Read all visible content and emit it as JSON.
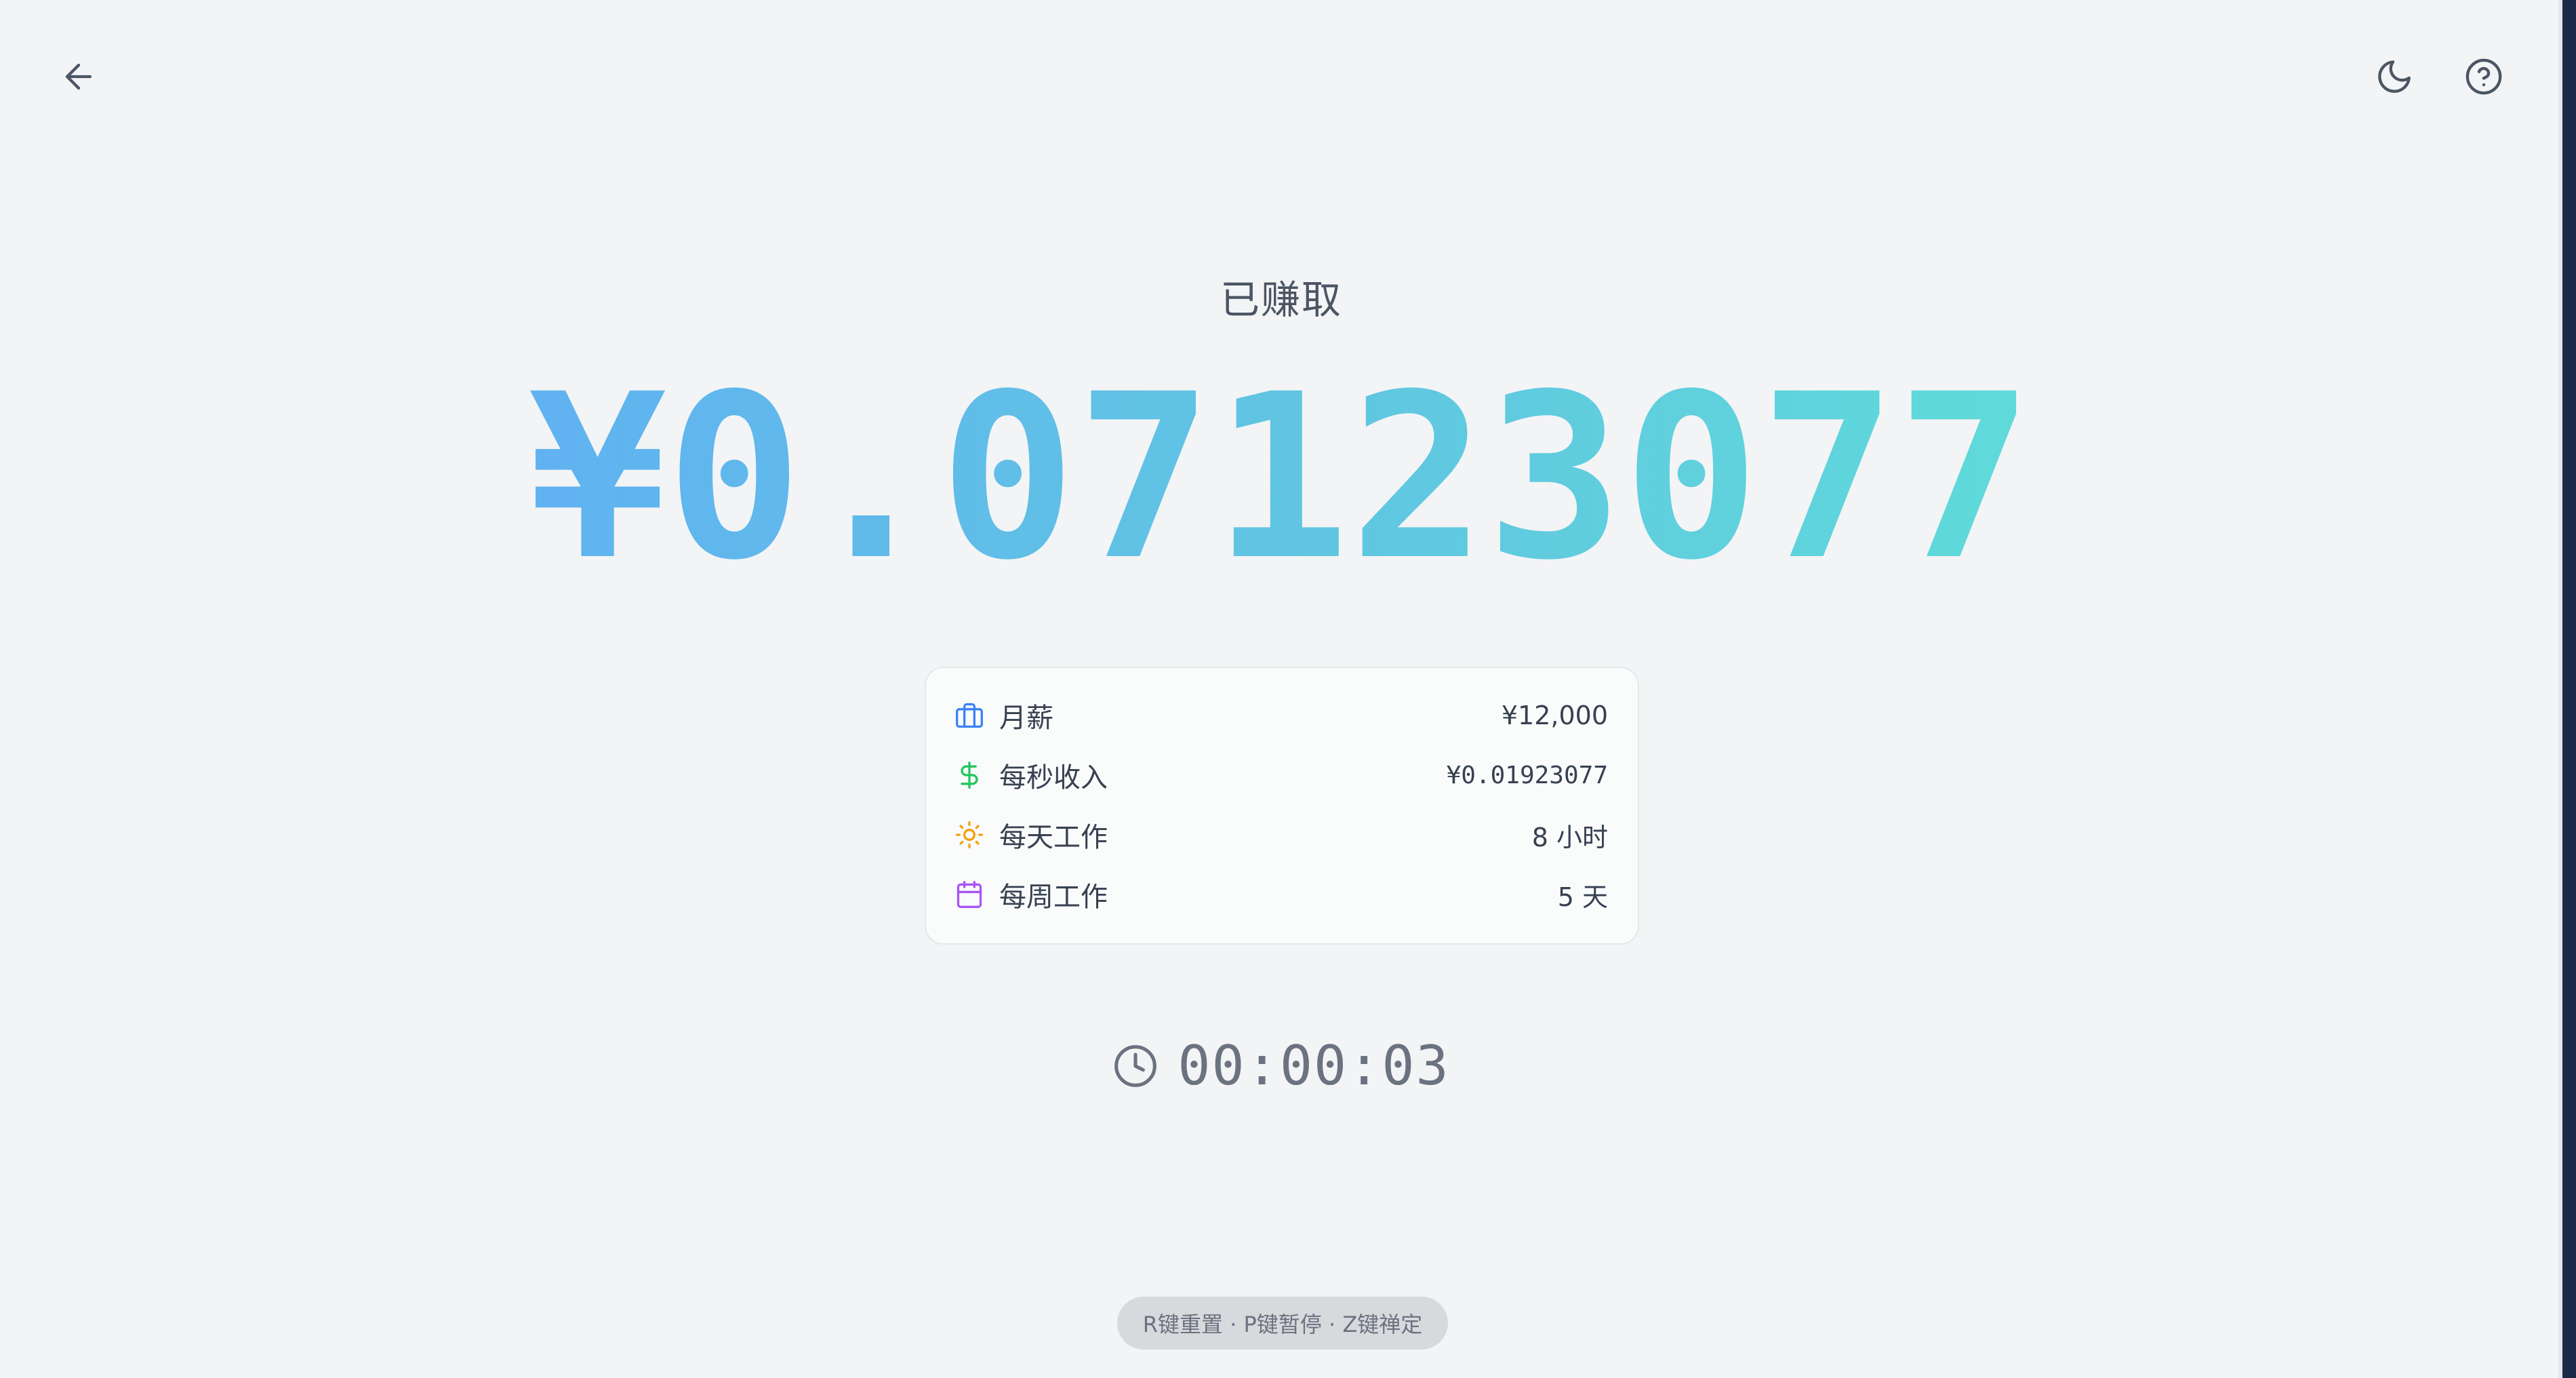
{
  "header": {
    "back_icon": "arrow-left-icon",
    "theme_icon": "moon-icon",
    "help_icon": "help-circle-icon"
  },
  "main": {
    "earned_label": "已赚取",
    "amount": "¥0.07123077"
  },
  "info_card": {
    "rows": [
      {
        "icon": "briefcase-icon",
        "label": "月薪",
        "value": "¥12,000",
        "color": "#3b82f6"
      },
      {
        "icon": "dollar-icon",
        "label": "每秒收入",
        "value": "¥0.01923077",
        "color": "#22c55e"
      },
      {
        "icon": "sun-icon",
        "label": "每天工作",
        "value": "8 小时",
        "color": "#f59e0b"
      },
      {
        "icon": "calendar-icon",
        "label": "每周工作",
        "value": "5 天",
        "color": "#a855f7"
      }
    ]
  },
  "timer": {
    "icon": "clock-icon",
    "elapsed": "00:00:03"
  },
  "footer": {
    "hint": "R键重置 · P键暂停 · Z键禅定"
  },
  "colors": {
    "background": "#f3f4f6",
    "gradient_start": "#60a5fa",
    "gradient_end": "#5eead4",
    "text_muted": "#6b7280"
  }
}
